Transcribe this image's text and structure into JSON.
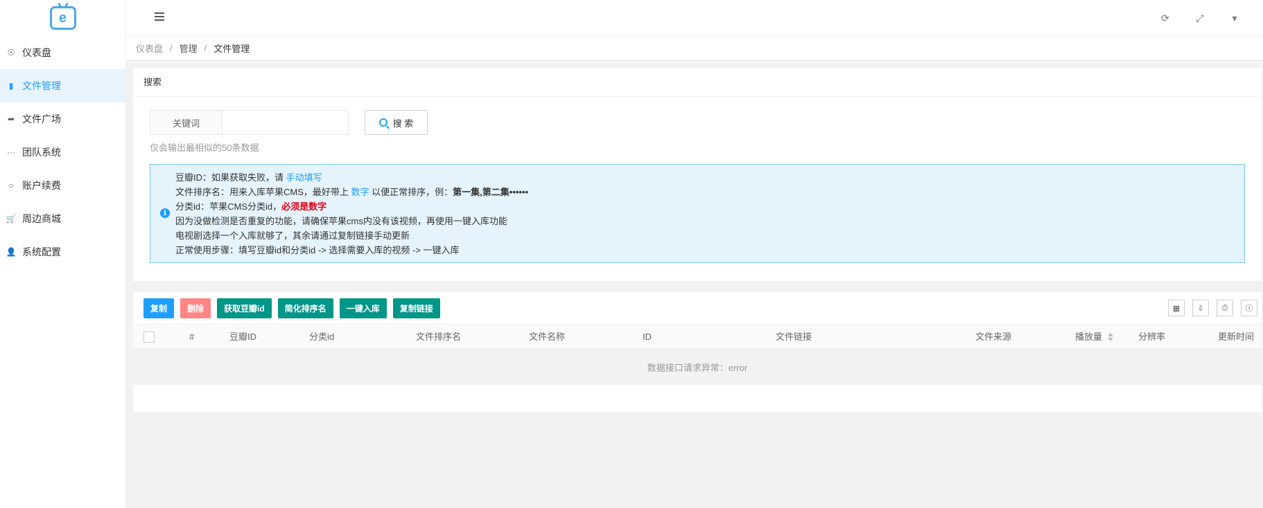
{
  "logo": {
    "letter": "e"
  },
  "sidebar": {
    "items": [
      {
        "label": "仪表盘",
        "icon": "dashboard-icon",
        "glyph": "☉"
      },
      {
        "label": "文件管理",
        "icon": "file-icon",
        "glyph": "▮"
      },
      {
        "label": "文件广场",
        "icon": "share-icon",
        "glyph": "➦"
      },
      {
        "label": "团队系统",
        "icon": "dots-icon",
        "glyph": "···"
      },
      {
        "label": "账户续费",
        "icon": "circle-icon",
        "glyph": "○"
      },
      {
        "label": "周边商城",
        "icon": "cart-icon",
        "glyph": "🛒"
      },
      {
        "label": "系统配置",
        "icon": "user-icon",
        "glyph": "👤"
      }
    ],
    "active_index": 1
  },
  "header": {
    "icons": [
      {
        "name": "refresh-icon",
        "glyph": "⟳"
      },
      {
        "name": "fullscreen-icon",
        "glyph": "⤢"
      },
      {
        "name": "dropdown-icon",
        "glyph": "▾"
      }
    ]
  },
  "breadcrumb": [
    "仪表盘",
    "管理",
    "文件管理"
  ],
  "search": {
    "title": "搜索",
    "keyword_label": "关键词",
    "keyword_value": "",
    "button_label": "搜 索",
    "hint": "仅会输出最相似的50条数据"
  },
  "notice": {
    "line1_prefix": "豆瓣ID：如果获取失败，请 ",
    "line1_link": "手动填写",
    "line2_prefix": "文件排序名：用来入库苹果CMS，最好带上 ",
    "line2_link": "数字",
    "line2_mid": " 以便正常排序，例：",
    "line2_bold": "第一集,第二集••••••",
    "line3_prefix": "分类id：苹果CMS分类id，",
    "line3_red": "必须是数字",
    "line4": "因为没做检测是否重复的功能，请确保苹果cms内没有该视频，再使用一键入库功能",
    "line5": "电视剧选择一个入库就够了，其余请通过复制链接手动更新",
    "line6": "正常使用步骤：填写豆瓣id和分类id -> 选择需要入库的视频 -> 一键入库"
  },
  "toolbar": {
    "copy": "复制",
    "delete": "删除",
    "fetch_douban": "获取豆瓣id",
    "simplify": "简化排序名",
    "import": "一键入库",
    "copy_link": "复制链接"
  },
  "table": {
    "columns": [
      "#",
      "豆瓣ID",
      "分类id",
      "文件排序名",
      "文件名称",
      "ID",
      "文件链接",
      "文件来源",
      "播放量",
      "分辨率",
      "更新时间"
    ],
    "empty_message": "数据接口请求异常：error"
  }
}
